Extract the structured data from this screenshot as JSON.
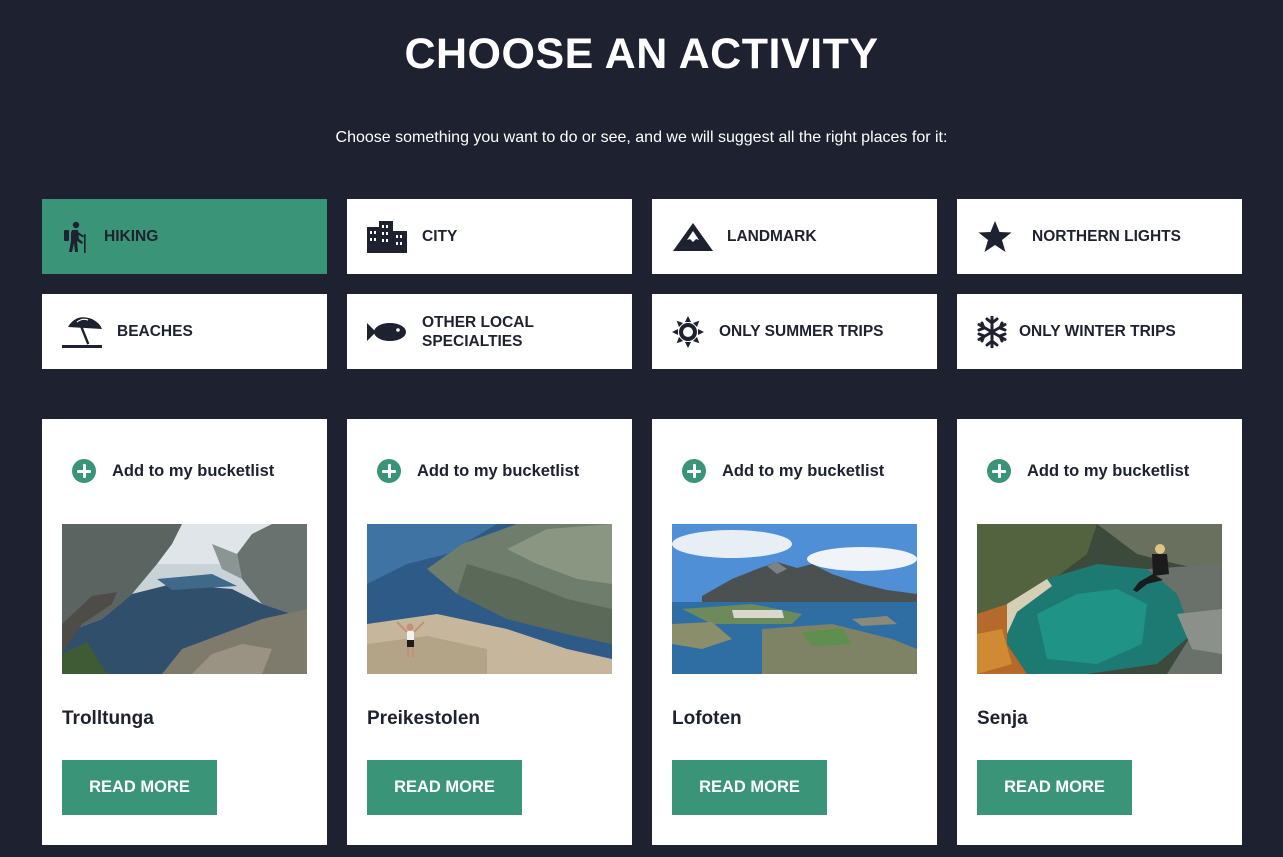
{
  "header": {
    "title": "CHOOSE AN ACTIVITY",
    "subtitle": "Choose something you want to do or see, and we will suggest all the right places for it:"
  },
  "activities": [
    {
      "label": "HIKING",
      "icon": "hiker-icon",
      "active": true
    },
    {
      "label": "CITY",
      "icon": "city-buildings-icon",
      "active": false
    },
    {
      "label": "LANDMARK",
      "icon": "mountain-icon",
      "active": false
    },
    {
      "label": "NORTHERN LIGHTS",
      "icon": "star-icon",
      "active": false
    },
    {
      "label": "BEACHES",
      "icon": "beach-umbrella-icon",
      "active": false
    },
    {
      "label": "OTHER LOCAL SPECIALTIES",
      "icon": "fish-icon",
      "active": false
    },
    {
      "label": "ONLY SUMMER TRIPS",
      "icon": "sun-icon",
      "active": false
    },
    {
      "label": "ONLY WINTER TRIPS",
      "icon": "snowflake-icon",
      "active": false
    }
  ],
  "colors": {
    "background": "#1e2230",
    "accent": "#3a9478",
    "card": "#ffffff",
    "text": "#1e2230"
  },
  "cards": [
    {
      "bucket_label": "Add to my bucketlist",
      "title": "Trolltunga",
      "button": "READ MORE"
    },
    {
      "bucket_label": "Add to my bucketlist",
      "title": "Preikestolen",
      "button": "READ MORE"
    },
    {
      "bucket_label": "Add to my bucketlist",
      "title": "Lofoten",
      "button": "READ MORE"
    },
    {
      "bucket_label": "Add to my bucketlist",
      "title": "Senja",
      "button": "READ MORE"
    }
  ]
}
